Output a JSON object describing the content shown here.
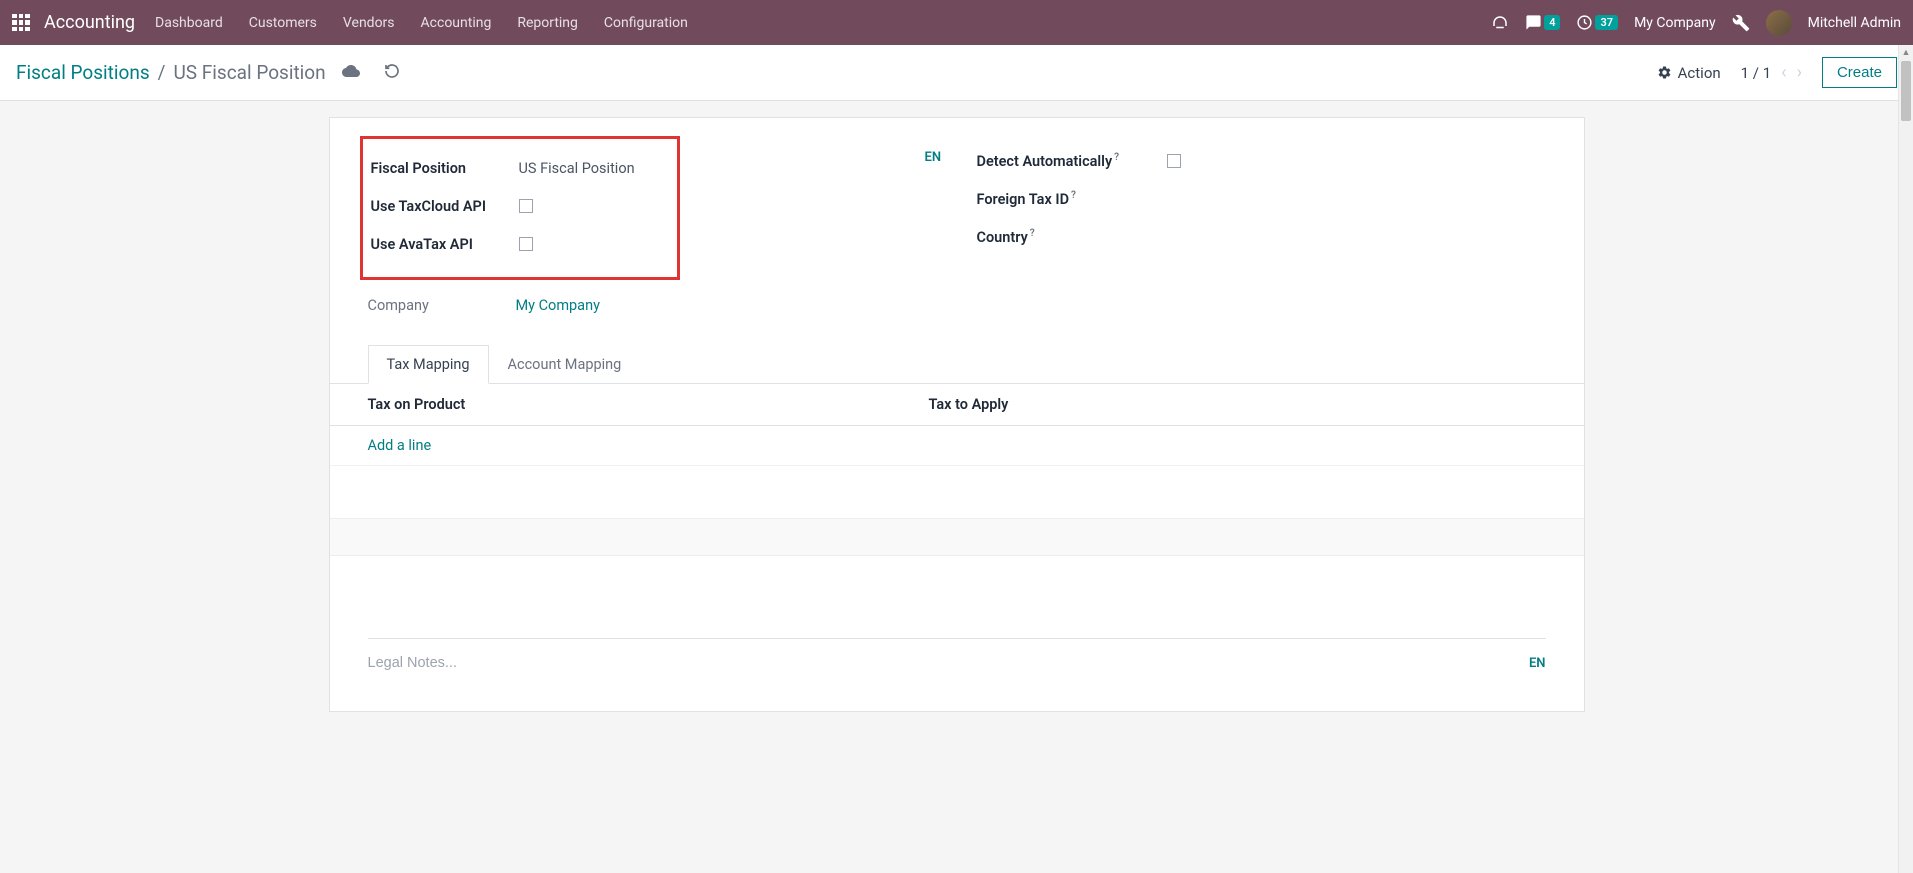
{
  "nav": {
    "brand": "Accounting",
    "items": [
      "Dashboard",
      "Customers",
      "Vendors",
      "Accounting",
      "Reporting",
      "Configuration"
    ],
    "msg_count": "4",
    "clock_count": "37",
    "company": "My Company",
    "user": "Mitchell Admin"
  },
  "breadcrumb": {
    "parent": "Fiscal Positions",
    "current": "US Fiscal Position"
  },
  "controls": {
    "action": "Action",
    "pager": "1 / 1",
    "create": "Create"
  },
  "form": {
    "fiscal_position_label": "Fiscal Position",
    "fiscal_position_value": "US Fiscal Position",
    "use_taxcloud_label": "Use TaxCloud API",
    "use_avatax_label": "Use AvaTax API",
    "company_label": "Company",
    "company_value": "My Company",
    "en": "EN",
    "detect_auto_label": "Detect Automatically",
    "foreign_tax_label": "Foreign Tax ID",
    "country_label": "Country"
  },
  "tabs": {
    "tax_mapping": "Tax Mapping",
    "account_mapping": "Account Mapping"
  },
  "table": {
    "col1": "Tax on Product",
    "col2": "Tax to Apply",
    "add_line": "Add a line"
  },
  "legal": {
    "placeholder": "Legal Notes...",
    "en": "EN"
  }
}
